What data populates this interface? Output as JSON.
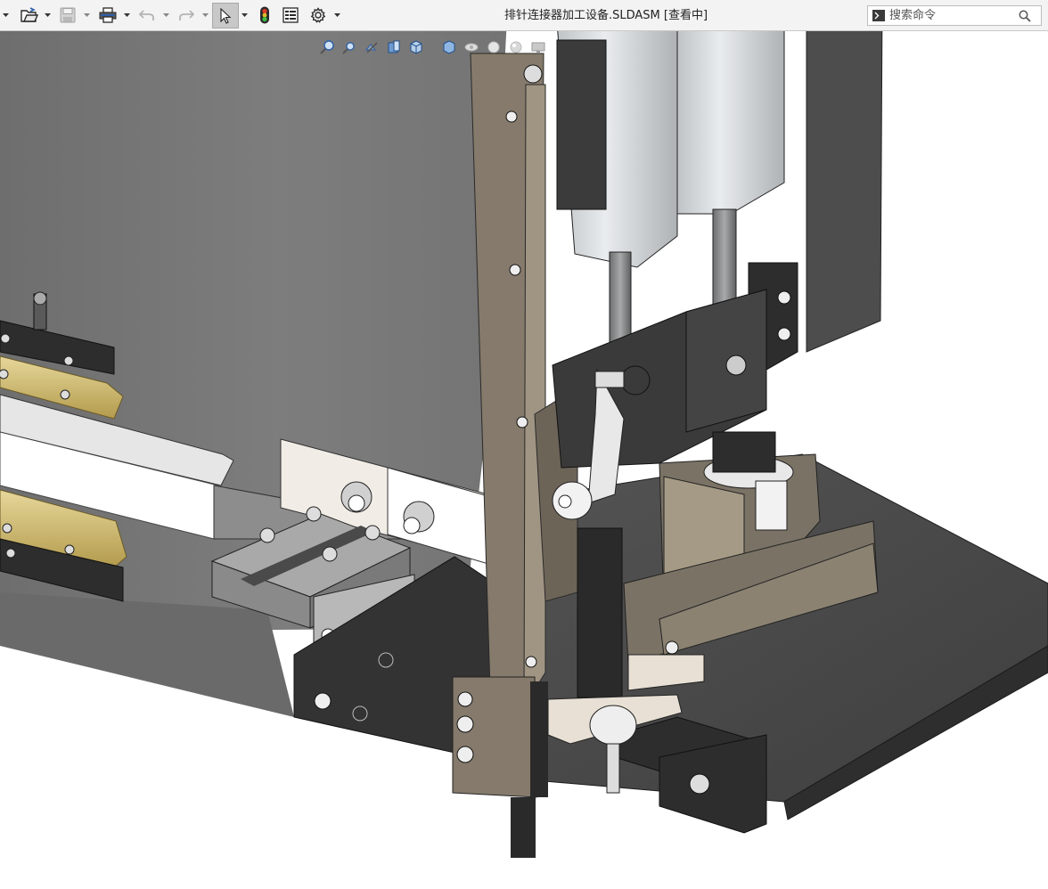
{
  "window": {
    "title": "排针连接器加工设备.SLDASM [查看中]"
  },
  "toolbar": {
    "items": [
      {
        "name": "new-document",
        "icon": "new-file-icon",
        "has_dropdown": true
      },
      {
        "name": "open-document",
        "icon": "folder-open-icon",
        "has_dropdown": true
      },
      {
        "name": "save",
        "icon": "save-icon",
        "has_dropdown": true,
        "enabled": false
      },
      {
        "name": "print",
        "icon": "printer-icon",
        "has_dropdown": true
      },
      {
        "name": "undo",
        "icon": "undo-icon",
        "has_dropdown": true,
        "enabled": false
      },
      {
        "name": "redo",
        "icon": "redo-icon",
        "has_dropdown": true,
        "enabled": false
      },
      {
        "name": "select",
        "icon": "cursor-arrow-icon",
        "has_dropdown": true,
        "active": true
      },
      {
        "name": "rebuild",
        "icon": "traffic-light-icon"
      },
      {
        "name": "file-properties",
        "icon": "properties-icon"
      },
      {
        "name": "options",
        "icon": "gear-icon",
        "has_dropdown": true
      }
    ]
  },
  "search": {
    "placeholder": "搜索命令"
  },
  "heads_up_toolbar": {
    "items": [
      "zoom-to-fit-icon",
      "zoom-to-area-icon",
      "previous-view-icon",
      "section-view-icon",
      "view-orientation-icon",
      "display-style-icon",
      "hide-show-items-icon",
      "edit-appearance-icon",
      "apply-scene-icon",
      "view-settings-icon"
    ]
  },
  "colors": {
    "toolbar_bg": "#f3f3f3",
    "plate_dark": "#5e5e5e",
    "plate_face": "#7a7a7a",
    "bronze": "#7d7264",
    "brass": "#c8b46a",
    "base_plate": "#474747"
  }
}
